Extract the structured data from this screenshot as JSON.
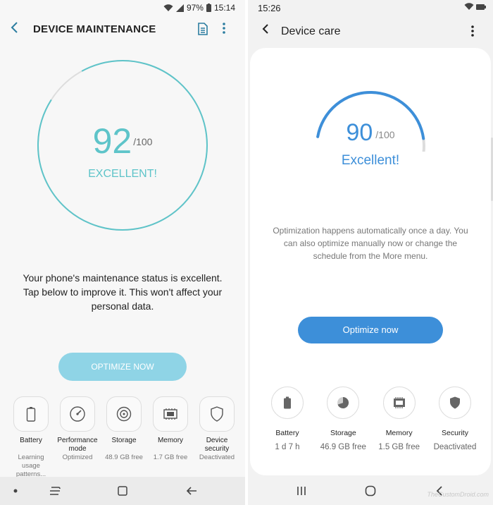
{
  "left": {
    "status_bar": {
      "battery": "97%",
      "time": "15:14"
    },
    "app_bar": {
      "title": "DEVICE MAINTENANCE"
    },
    "score": {
      "value": "92",
      "max": "/100",
      "label": "EXCELLENT!",
      "fraction": 0.92
    },
    "description": "Your phone's maintenance status is excellent. Tap below to improve it. This won't affect your personal data.",
    "optimize_label": "OPTIMIZE NOW",
    "cards": [
      {
        "label": "Battery",
        "value": "Learning usage patterns...",
        "icon": "battery-icon"
      },
      {
        "label": "Performance mode",
        "value": "Optimized",
        "icon": "speedometer-icon"
      },
      {
        "label": "Storage",
        "value": "48.9 GB free",
        "icon": "storage-icon"
      },
      {
        "label": "Memory",
        "value": "1.7 GB free",
        "icon": "memory-chip-icon"
      },
      {
        "label": "Device security",
        "value": "Deactivated",
        "icon": "shield-icon"
      }
    ],
    "colors": {
      "accent": "#5ec4c9",
      "button": "#8fd4e6"
    }
  },
  "right": {
    "status_bar": {
      "time": "15:26"
    },
    "app_bar": {
      "title": "Device care"
    },
    "score": {
      "value": "90",
      "max": "/100",
      "label": "Excellent!",
      "fraction": 0.9
    },
    "description": "Optimization happens automatically once a day. You can also optimize manually now or change the schedule from the More menu.",
    "optimize_label": "Optimize now",
    "items": [
      {
        "label": "Battery",
        "value": "1 d 7 h",
        "icon": "battery-icon"
      },
      {
        "label": "Storage",
        "value": "46.9 GB free",
        "icon": "pie-chart-icon"
      },
      {
        "label": "Memory",
        "value": "1.5 GB free",
        "icon": "memory-chip-icon"
      },
      {
        "label": "Security",
        "value": "Deactivated",
        "icon": "shield-icon"
      }
    ],
    "watermark": "TheCustomDroid.com",
    "colors": {
      "accent": "#3d8fd9"
    }
  }
}
